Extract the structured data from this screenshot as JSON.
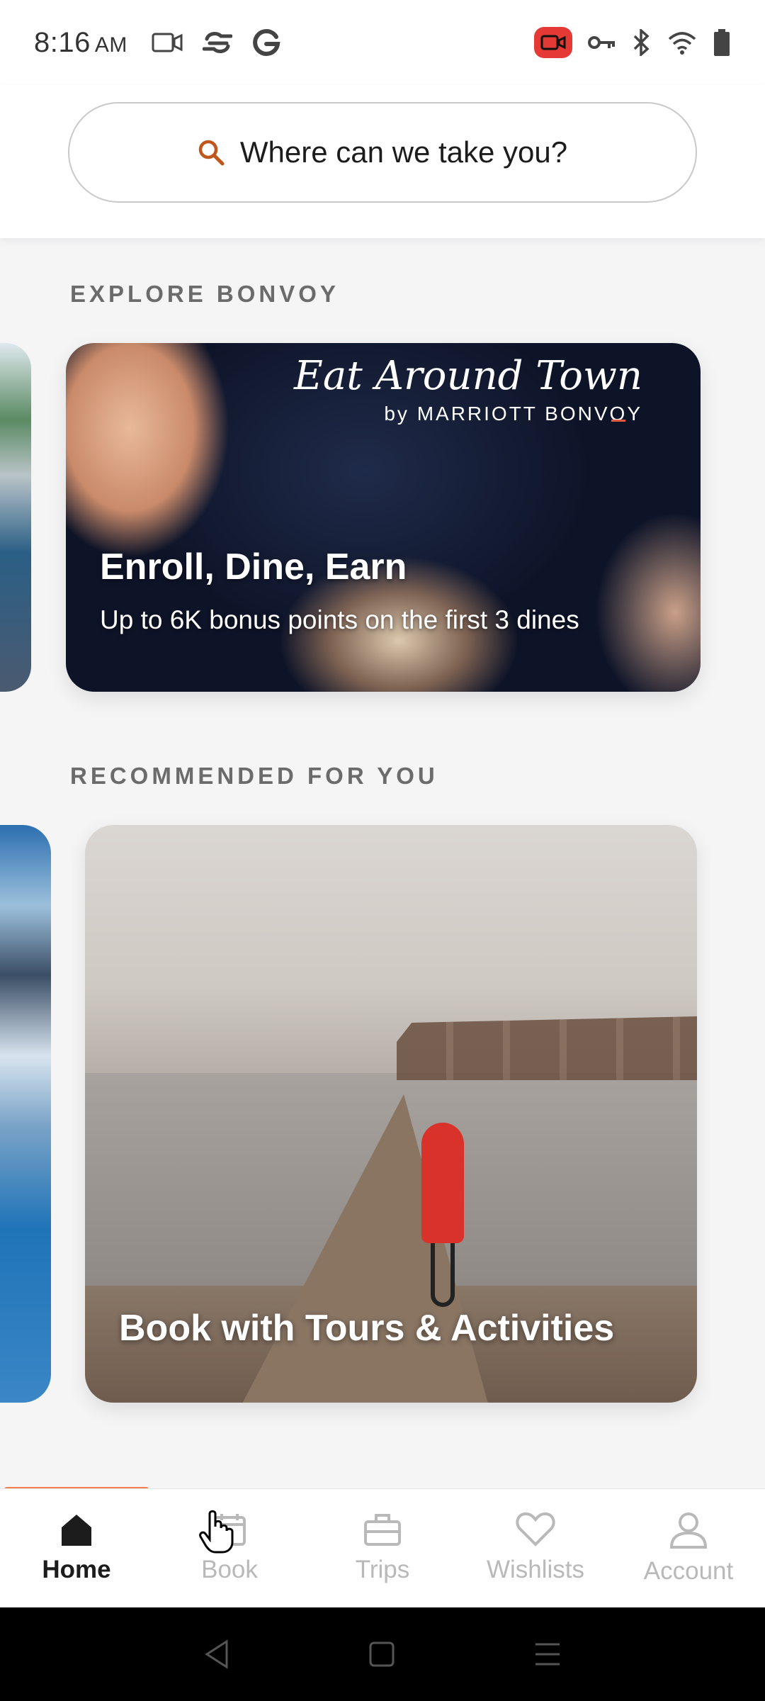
{
  "status_bar": {
    "time": "8:16",
    "ampm": "AM",
    "left_icons": [
      "video-camera-icon",
      "cloud-sync-icon",
      "google-icon"
    ],
    "right_icons": [
      "screen-record-icon",
      "vpn-key-icon",
      "bluetooth-icon",
      "wifi-icon",
      "battery-icon"
    ]
  },
  "search": {
    "placeholder": "Where can we take you?",
    "icon": "search-icon",
    "icon_color": "#c0561c"
  },
  "explore": {
    "section_title": "EXPLORE BONVOY",
    "card": {
      "brand_title": "Eat Around Town",
      "brand_sub": "by MARRIOTT BONV",
      "brand_sub_o": "O",
      "brand_sub_end": "Y",
      "heading": "Enroll, Dine, Earn",
      "subtext": "Up to 6K bonus points on the first 3 dines"
    }
  },
  "recommended": {
    "section_title": "RECOMMENDED FOR YOU",
    "card": {
      "heading": "Book with Tours & Activities"
    }
  },
  "bottom_nav": {
    "active": "Home",
    "accent_color": "#f27d4d",
    "items": [
      {
        "label": "Home",
        "icon": "home-icon"
      },
      {
        "label": "Book",
        "icon": "calendar-icon"
      },
      {
        "label": "Trips",
        "icon": "suitcase-icon"
      },
      {
        "label": "Wishlists",
        "icon": "heart-icon"
      },
      {
        "label": "Account",
        "icon": "person-icon"
      }
    ]
  },
  "system_nav": [
    "back-icon",
    "home-square-icon",
    "menu-icon"
  ]
}
